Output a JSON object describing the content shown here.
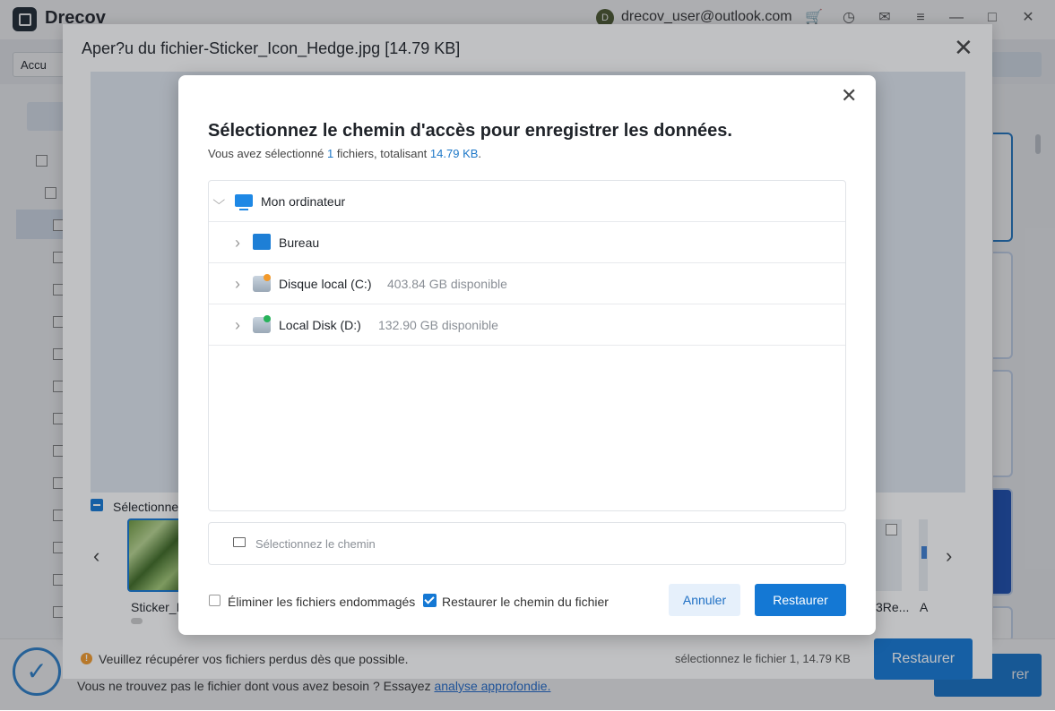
{
  "app": {
    "name": "Drecov",
    "user_initial": "D",
    "user_email": "drecov_user@outlook.com",
    "breadcrumb": "Accu"
  },
  "background": {
    "bottom_text": "Vous ne trouvez pas le fichier dont vous avez besoin ? Essayez",
    "bottom_link": "analyse approfondie.",
    "restore_label": "rer"
  },
  "preview": {
    "title": "Aper?u du fichier-Sticker_Icon_Hedge.jpg [14.79 KB]",
    "select_label": "Sélectionner",
    "thumb_name": "Sticker_Ic",
    "thumb2_name": "3Re...",
    "thumb3_name": "A",
    "warning": "Veuillez récupérer vos fichiers perdus dès que possible.",
    "selected_count": "sélectionnez le fichier 1, 14.79 KB",
    "restore_label": "Restaurer"
  },
  "modal": {
    "title": "Sélectionnez le chemin d'accès pour enregistrer les données.",
    "sub_prefix": "Vous avez sélectionné",
    "sub_count": "1",
    "sub_middle": "fichiers, totalisant",
    "sub_size": "14.79 KB",
    "sub_suffix": ".",
    "tree": {
      "root": "Mon ordinateur",
      "items": [
        {
          "label": "Bureau",
          "free": ""
        },
        {
          "label": "Disque local (C:)",
          "free": "403.84 GB disponible"
        },
        {
          "label": "Local Disk (D:)",
          "free": "132.90 GB disponible"
        }
      ]
    },
    "path_placeholder": "Sélectionnez le chemin",
    "option_damaged": "Éliminer les fichiers endommagés",
    "option_damaged_checked": false,
    "option_restore_path": "Restaurer le chemin du fichier",
    "option_restore_path_checked": true,
    "cancel_label": "Annuler",
    "restore_label": "Restaurer"
  },
  "icons": {
    "warning": "!",
    "close": "✕",
    "chevron_down": "⌵",
    "chevron_right": "›",
    "prev": "‹",
    "next": "›",
    "check": "✓"
  },
  "colors": {
    "accent": "#1478d4",
    "warning": "#f39a2b",
    "disk_c_badge": "#f39a2b",
    "disk_d_badge": "#27b35a"
  }
}
